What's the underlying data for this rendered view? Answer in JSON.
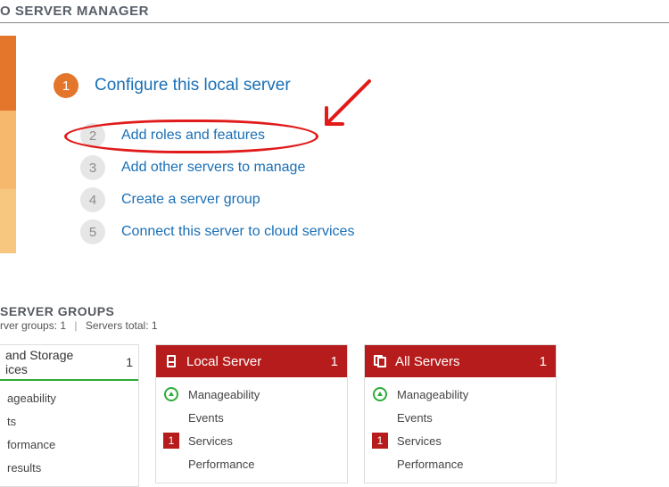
{
  "topbar": {
    "title": "O SERVER MANAGER"
  },
  "steps": {
    "s1": {
      "num": "1",
      "label": "Configure this local server"
    },
    "s2": {
      "num": "2",
      "label": "Add roles and features"
    },
    "s3": {
      "num": "3",
      "label": "Add other servers to manage"
    },
    "s4": {
      "num": "4",
      "label": "Create a server group"
    },
    "s5": {
      "num": "5",
      "label": "Connect this server to cloud services"
    }
  },
  "groups": {
    "title": "SERVER GROUPS",
    "sub_left": "rver groups: 1",
    "sub_right": "Servers total: 1"
  },
  "tiles": {
    "storage": {
      "title_l1": "and Storage",
      "title_l2": "ices",
      "count": "1",
      "rows": [
        "ageability",
        "ts",
        "formance",
        "results"
      ]
    },
    "local": {
      "title": "Local Server",
      "count": "1",
      "rows": {
        "manage": "Manageability",
        "events": "Events",
        "services": "Services",
        "services_badge": "1",
        "perf": "Performance"
      }
    },
    "all": {
      "title": "All Servers",
      "count": "1",
      "rows": {
        "manage": "Manageability",
        "events": "Events",
        "services": "Services",
        "services_badge": "1",
        "perf": "Performance"
      }
    }
  }
}
